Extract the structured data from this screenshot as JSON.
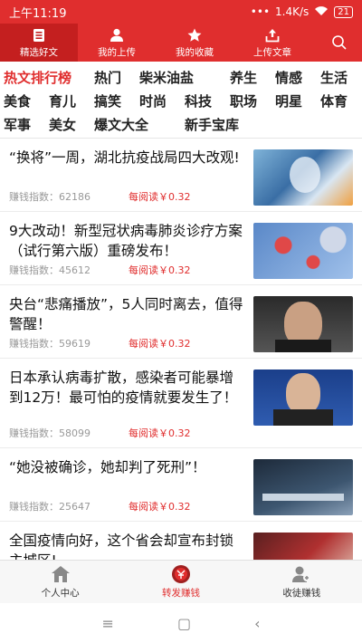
{
  "status_bar": {
    "time": "上午11:19",
    "network": "1.4K/s",
    "battery": "21"
  },
  "top_nav": {
    "items": [
      {
        "label": "精选好文",
        "icon": "document-icon",
        "active": true
      },
      {
        "label": "我的上传",
        "icon": "user-icon",
        "active": false
      },
      {
        "label": "我的收藏",
        "icon": "star-icon",
        "active": false
      },
      {
        "label": "上传文章",
        "icon": "upload-icon",
        "active": false
      }
    ],
    "search_icon": "search-icon"
  },
  "categories": {
    "rows": [
      [
        "热文排行榜",
        "热门",
        "柴米油盐",
        "养生",
        "情感",
        "生活"
      ],
      [
        "美食",
        "育儿",
        "搞笑",
        "时尚",
        "科技",
        "职场",
        "明星",
        "体育"
      ],
      [
        "军事",
        "美女",
        "爆文大全",
        "新手宝库"
      ]
    ],
    "active": "热文排行榜"
  },
  "articles": [
    {
      "title": "“换将”一周，湖北抗疫战局四大改观!",
      "score_label": "赚钱指数：62186",
      "reward": "每阅读￥0.32"
    },
    {
      "title": "9大改动！新型冠状病毒肺炎诊疗方案（试行第六版）重磅发布！",
      "score_label": "赚钱指数：45612",
      "reward": "每阅读￥0.32"
    },
    {
      "title": "央台“悲痛播放”，5人同时离去，值得警醒！",
      "score_label": "赚钱指数：59619",
      "reward": "每阅读￥0.32"
    },
    {
      "title": "日本承认病毒扩散，感染者可能暴增到12万！最可怕的疫情就要发生了！",
      "score_label": "赚钱指数：58099",
      "reward": "每阅读￥0.32"
    },
    {
      "title": "“她没被确诊，她却判了死刑”！",
      "score_label": "赚钱指数：25647",
      "reward": "每阅读￥0.32"
    },
    {
      "title": "全国疫情向好，这个省会却宣布封锁主城区!",
      "score_label": "",
      "reward": ""
    }
  ],
  "bottom_tabs": [
    {
      "label": "个人中心",
      "icon": "home-icon",
      "active": false
    },
    {
      "label": "转发赚钱",
      "icon": "forward-earn-icon",
      "active": true
    },
    {
      "label": "收徒赚钱",
      "icon": "recruit-icon",
      "active": false
    }
  ],
  "system_nav": {
    "menu": "≡",
    "home": "▢",
    "back": "‹"
  },
  "colors": {
    "brand": "#e02e2e",
    "brand_dark": "#c41f1f"
  }
}
